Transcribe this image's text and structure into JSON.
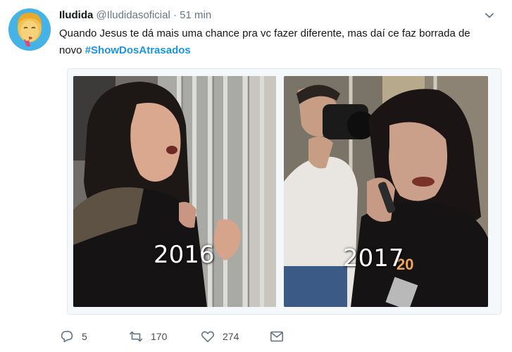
{
  "tweet": {
    "author": {
      "display_name": "Iludida",
      "handle": "@Iludidasoficial",
      "separator": "·",
      "timestamp": "51 min"
    },
    "text_before": "Quando Jesus te dá mais uma  chance pra vc fazer diferente, mas daí ce faz borrada de novo ",
    "hashtag": "#ShowDosAtrasados",
    "media": [
      {
        "caption": "2016"
      },
      {
        "caption": "2017"
      }
    ],
    "actions": {
      "reply_count": "5",
      "retweet_count": "170",
      "like_count": "274"
    },
    "icons": {
      "reply": "reply-icon",
      "retweet": "retweet-icon",
      "like": "heart-icon",
      "dm": "envelope-icon",
      "menu": "chevron-down-icon"
    }
  }
}
